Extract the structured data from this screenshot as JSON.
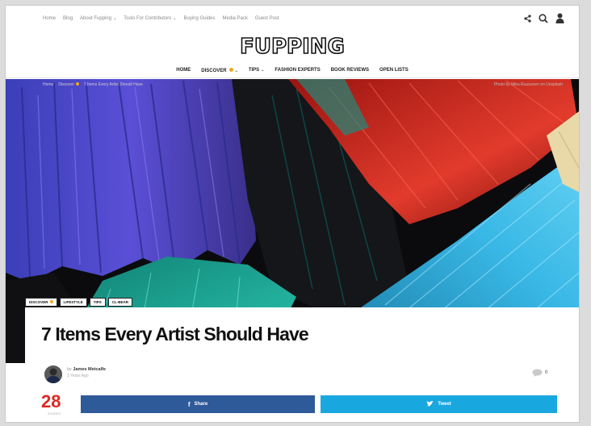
{
  "top_nav": [
    "Home",
    "Blog",
    "About Fupping",
    "Tools For Contributors",
    "Buying Guides",
    "Media Pack",
    "Guest Post"
  ],
  "top_nav_dropdowns": [
    false,
    false,
    true,
    true,
    false,
    false,
    false
  ],
  "logo": "FUPPING",
  "main_nav": [
    {
      "label": "HOME",
      "dot": false,
      "caret": false
    },
    {
      "label": "DISCOVER",
      "dot": true,
      "caret": true
    },
    {
      "label": "TIPS",
      "dot": false,
      "caret": true
    },
    {
      "label": "FASHION EXPERTS",
      "dot": false,
      "caret": false
    },
    {
      "label": "BOOK REVIEWS",
      "dot": false,
      "caret": false
    },
    {
      "label": "OPEN LISTS",
      "dot": false,
      "caret": false
    }
  ],
  "breadcrumb": [
    "Home",
    "Discover",
    "7 Items Every Artist Should Have"
  ],
  "photo_credit": "Photo by Mika Ruusunen on Unsplash",
  "tags": [
    {
      "label": "DISCOVER",
      "dot": true
    },
    {
      "label": "LIFESTYLE",
      "dot": false
    },
    {
      "label": "TIPS",
      "dot": false
    },
    {
      "label": "CL-BEAR",
      "dot": false
    }
  ],
  "article": {
    "title": "7 Items Every Artist Should Have",
    "author_prefix": "by",
    "author": "James Metcalfe",
    "date": "3 Years Ago",
    "comments": "0"
  },
  "share": {
    "count": "28",
    "count_label": "SHARES",
    "facebook_label": "Share",
    "twitter_label": "Tweet"
  },
  "colors": {
    "accent": "#f2a818",
    "share_count": "#dd2a24",
    "facebook": "#2f5a9a",
    "twitter": "#19a7e0"
  }
}
